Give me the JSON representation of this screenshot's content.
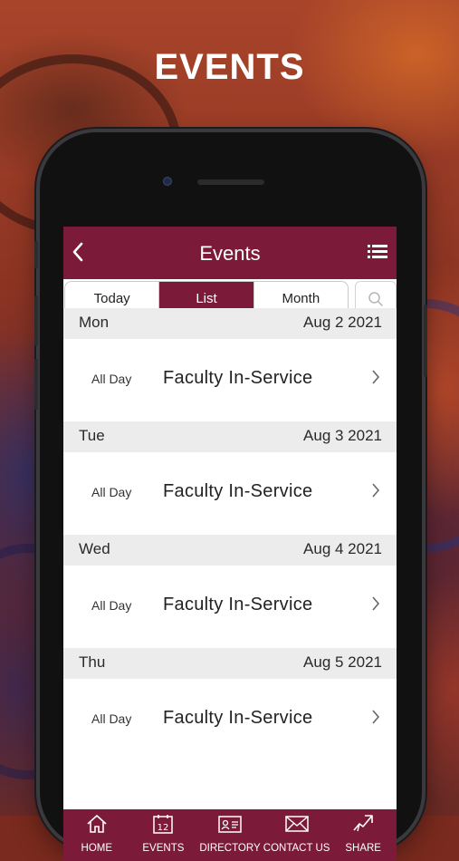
{
  "heading": "EVENTS",
  "navbar": {
    "title": "Events",
    "back_icon": "chevron-left-icon",
    "menu_icon": "list-icon"
  },
  "segments": {
    "today": "Today",
    "list": "List",
    "month": "Month",
    "selected": "List"
  },
  "search_icon": "search-icon",
  "days": [
    {
      "day": "Mon",
      "date": "Aug 2 2021",
      "time": "All Day",
      "event": "Faculty In-Service"
    },
    {
      "day": "Tue",
      "date": "Aug 3 2021",
      "time": "All Day",
      "event": "Faculty In-Service"
    },
    {
      "day": "Wed",
      "date": "Aug 4 2021",
      "time": "All Day",
      "event": "Faculty In-Service"
    },
    {
      "day": "Thu",
      "date": "Aug 5 2021",
      "time": "All Day",
      "event": "Faculty In-Service"
    }
  ],
  "tabs": [
    {
      "label": "HOME",
      "icon": "home-icon"
    },
    {
      "label": "EVENTS",
      "icon": "calendar-icon",
      "icon_text": "12"
    },
    {
      "label": "DIRECTORY",
      "icon": "contact-card-icon"
    },
    {
      "label": "CONTACT US",
      "icon": "envelope-icon"
    },
    {
      "label": "SHARE",
      "icon": "share-icon"
    }
  ],
  "colors": {
    "brand": "#7c1a3a",
    "section_bg": "#ececec"
  }
}
